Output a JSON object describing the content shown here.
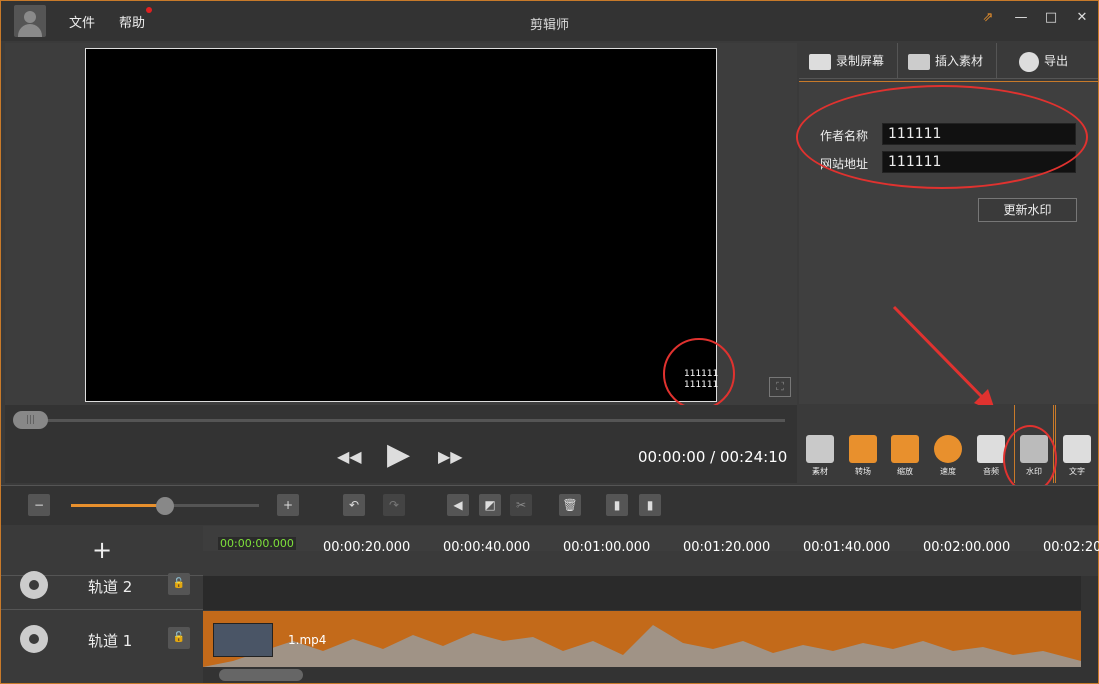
{
  "titlebar": {
    "title": "剪辑师",
    "menu": [
      "文件",
      "帮助"
    ]
  },
  "preview": {
    "watermark_lines": [
      "111111",
      "111111"
    ]
  },
  "playback": {
    "time": "00:00:00 / 00:24:10",
    "prev": "◀◀",
    "play": "▶",
    "next": "▶▶"
  },
  "right_tabs": [
    {
      "label": "录制屏幕",
      "icon": "record-camera-icon"
    },
    {
      "label": "插入素材",
      "icon": "camera-icon"
    },
    {
      "label": "导出",
      "icon": "film-reel-icon"
    }
  ],
  "watermark_form": {
    "author_label": "作者名称",
    "author_value": "111111",
    "site_label": "网站地址",
    "site_value": "111111",
    "update_button": "更新水印"
  },
  "tools": [
    {
      "label": "素材",
      "icon": "folder-icon"
    },
    {
      "label": "转场",
      "icon": "transition-icon"
    },
    {
      "label": "缩放",
      "icon": "zoom-icon"
    },
    {
      "label": "速度",
      "icon": "speed-icon"
    },
    {
      "label": "音频",
      "icon": "speaker-icon"
    },
    {
      "label": "水印",
      "icon": "stamp-icon"
    },
    {
      "label": "文字",
      "icon": "pencil-icon"
    }
  ],
  "timeline": {
    "add": "+",
    "start_time": "00:00:00.000",
    "ticks": [
      "00:00:20.000",
      "00:00:40.000",
      "00:01:00.000",
      "00:01:20.000",
      "00:01:40.000",
      "00:02:00.000",
      "00:02:20"
    ],
    "tracks": [
      {
        "name": "轨道 2"
      },
      {
        "name": "轨道 1"
      }
    ],
    "clip_name": "1.mp4"
  },
  "zoom_level": 0.5
}
